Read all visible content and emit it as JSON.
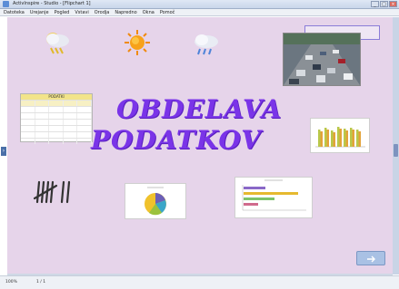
{
  "window": {
    "title": "ActivInspire - Studio - [Flipchart 1]"
  },
  "menubar": {
    "items": [
      "Datoteka",
      "Urejanje",
      "Pogled",
      "Vstavi",
      "Orodja",
      "Napredno",
      "Okna",
      "Pomoč"
    ]
  },
  "slide": {
    "title_line1": "OBDELAVA",
    "title_line2": "PODATKOV",
    "background": "#e6d4ea",
    "title_color": "#7a34e8"
  },
  "table": {
    "header": "PODATKI"
  },
  "statusbar": {
    "zoom": "100%",
    "page": "1 / 1"
  },
  "icons": {
    "weather": [
      "snow-cloud-icon",
      "sun-icon",
      "rain-cloud-icon"
    ],
    "tally": "tally-marks-icon",
    "nav": "next-page-icon"
  }
}
